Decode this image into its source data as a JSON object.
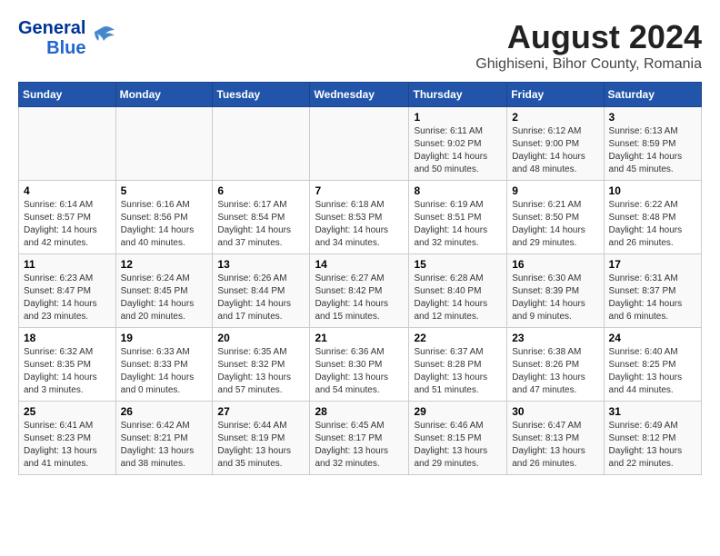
{
  "header": {
    "logo_line1": "General",
    "logo_line2": "Blue",
    "month_year": "August 2024",
    "location": "Ghighiseni, Bihor County, Romania"
  },
  "days_of_week": [
    "Sunday",
    "Monday",
    "Tuesday",
    "Wednesday",
    "Thursday",
    "Friday",
    "Saturday"
  ],
  "weeks": [
    [
      {
        "day": "",
        "info": ""
      },
      {
        "day": "",
        "info": ""
      },
      {
        "day": "",
        "info": ""
      },
      {
        "day": "",
        "info": ""
      },
      {
        "day": "1",
        "info": "Sunrise: 6:11 AM\nSunset: 9:02 PM\nDaylight: 14 hours\nand 50 minutes."
      },
      {
        "day": "2",
        "info": "Sunrise: 6:12 AM\nSunset: 9:00 PM\nDaylight: 14 hours\nand 48 minutes."
      },
      {
        "day": "3",
        "info": "Sunrise: 6:13 AM\nSunset: 8:59 PM\nDaylight: 14 hours\nand 45 minutes."
      }
    ],
    [
      {
        "day": "4",
        "info": "Sunrise: 6:14 AM\nSunset: 8:57 PM\nDaylight: 14 hours\nand 42 minutes."
      },
      {
        "day": "5",
        "info": "Sunrise: 6:16 AM\nSunset: 8:56 PM\nDaylight: 14 hours\nand 40 minutes."
      },
      {
        "day": "6",
        "info": "Sunrise: 6:17 AM\nSunset: 8:54 PM\nDaylight: 14 hours\nand 37 minutes."
      },
      {
        "day": "7",
        "info": "Sunrise: 6:18 AM\nSunset: 8:53 PM\nDaylight: 14 hours\nand 34 minutes."
      },
      {
        "day": "8",
        "info": "Sunrise: 6:19 AM\nSunset: 8:51 PM\nDaylight: 14 hours\nand 32 minutes."
      },
      {
        "day": "9",
        "info": "Sunrise: 6:21 AM\nSunset: 8:50 PM\nDaylight: 14 hours\nand 29 minutes."
      },
      {
        "day": "10",
        "info": "Sunrise: 6:22 AM\nSunset: 8:48 PM\nDaylight: 14 hours\nand 26 minutes."
      }
    ],
    [
      {
        "day": "11",
        "info": "Sunrise: 6:23 AM\nSunset: 8:47 PM\nDaylight: 14 hours\nand 23 minutes."
      },
      {
        "day": "12",
        "info": "Sunrise: 6:24 AM\nSunset: 8:45 PM\nDaylight: 14 hours\nand 20 minutes."
      },
      {
        "day": "13",
        "info": "Sunrise: 6:26 AM\nSunset: 8:44 PM\nDaylight: 14 hours\nand 17 minutes."
      },
      {
        "day": "14",
        "info": "Sunrise: 6:27 AM\nSunset: 8:42 PM\nDaylight: 14 hours\nand 15 minutes."
      },
      {
        "day": "15",
        "info": "Sunrise: 6:28 AM\nSunset: 8:40 PM\nDaylight: 14 hours\nand 12 minutes."
      },
      {
        "day": "16",
        "info": "Sunrise: 6:30 AM\nSunset: 8:39 PM\nDaylight: 14 hours\nand 9 minutes."
      },
      {
        "day": "17",
        "info": "Sunrise: 6:31 AM\nSunset: 8:37 PM\nDaylight: 14 hours\nand 6 minutes."
      }
    ],
    [
      {
        "day": "18",
        "info": "Sunrise: 6:32 AM\nSunset: 8:35 PM\nDaylight: 14 hours\nand 3 minutes."
      },
      {
        "day": "19",
        "info": "Sunrise: 6:33 AM\nSunset: 8:33 PM\nDaylight: 14 hours\nand 0 minutes."
      },
      {
        "day": "20",
        "info": "Sunrise: 6:35 AM\nSunset: 8:32 PM\nDaylight: 13 hours\nand 57 minutes."
      },
      {
        "day": "21",
        "info": "Sunrise: 6:36 AM\nSunset: 8:30 PM\nDaylight: 13 hours\nand 54 minutes."
      },
      {
        "day": "22",
        "info": "Sunrise: 6:37 AM\nSunset: 8:28 PM\nDaylight: 13 hours\nand 51 minutes."
      },
      {
        "day": "23",
        "info": "Sunrise: 6:38 AM\nSunset: 8:26 PM\nDaylight: 13 hours\nand 47 minutes."
      },
      {
        "day": "24",
        "info": "Sunrise: 6:40 AM\nSunset: 8:25 PM\nDaylight: 13 hours\nand 44 minutes."
      }
    ],
    [
      {
        "day": "25",
        "info": "Sunrise: 6:41 AM\nSunset: 8:23 PM\nDaylight: 13 hours\nand 41 minutes."
      },
      {
        "day": "26",
        "info": "Sunrise: 6:42 AM\nSunset: 8:21 PM\nDaylight: 13 hours\nand 38 minutes."
      },
      {
        "day": "27",
        "info": "Sunrise: 6:44 AM\nSunset: 8:19 PM\nDaylight: 13 hours\nand 35 minutes."
      },
      {
        "day": "28",
        "info": "Sunrise: 6:45 AM\nSunset: 8:17 PM\nDaylight: 13 hours\nand 32 minutes."
      },
      {
        "day": "29",
        "info": "Sunrise: 6:46 AM\nSunset: 8:15 PM\nDaylight: 13 hours\nand 29 minutes."
      },
      {
        "day": "30",
        "info": "Sunrise: 6:47 AM\nSunset: 8:13 PM\nDaylight: 13 hours\nand 26 minutes."
      },
      {
        "day": "31",
        "info": "Sunrise: 6:49 AM\nSunset: 8:12 PM\nDaylight: 13 hours\nand 22 minutes."
      }
    ]
  ]
}
